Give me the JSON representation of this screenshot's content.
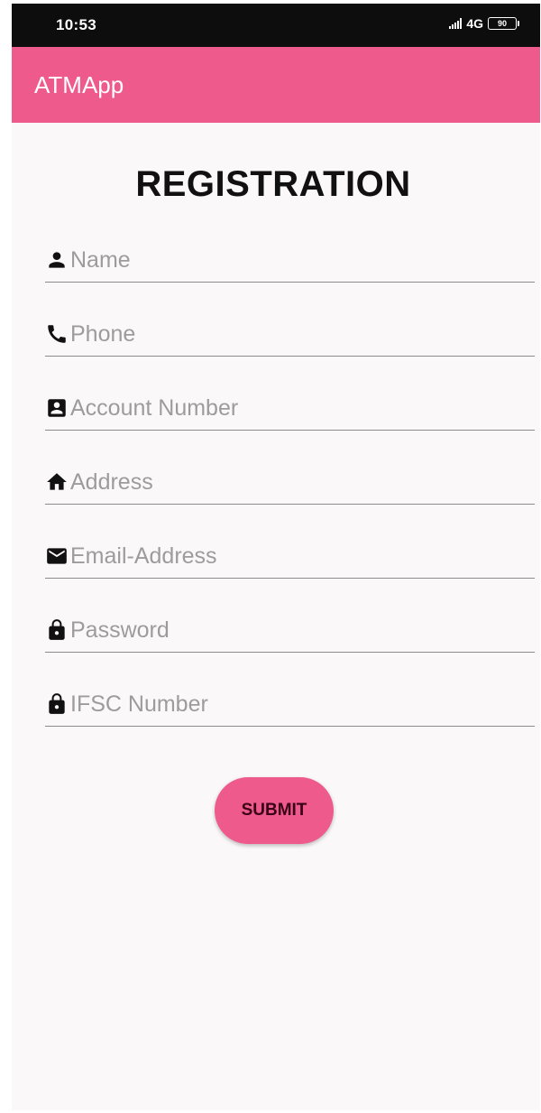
{
  "status_bar": {
    "time": "10:53",
    "network": "4G",
    "battery": "90"
  },
  "app_bar": {
    "title": "ATMApp"
  },
  "form": {
    "title": "REGISTRATION",
    "fields": [
      {
        "icon": "person-icon",
        "placeholder": "Name",
        "value": ""
      },
      {
        "icon": "phone-icon",
        "placeholder": "Phone",
        "value": ""
      },
      {
        "icon": "account-box-icon",
        "placeholder": "Account Number",
        "value": ""
      },
      {
        "icon": "home-icon",
        "placeholder": "Address",
        "value": ""
      },
      {
        "icon": "mail-icon",
        "placeholder": "Email-Address",
        "value": ""
      },
      {
        "icon": "lock-icon",
        "placeholder": "Password",
        "value": ""
      },
      {
        "icon": "lock-icon",
        "placeholder": "IFSC Number",
        "value": ""
      }
    ],
    "submit_label": "SUBMIT"
  },
  "colors": {
    "accent": "#ef5a8d",
    "status_bar": "#0d0d0d",
    "background": "#fbf8fa",
    "underline": "#8b8b8b",
    "placeholder": "#9c9c9c"
  }
}
